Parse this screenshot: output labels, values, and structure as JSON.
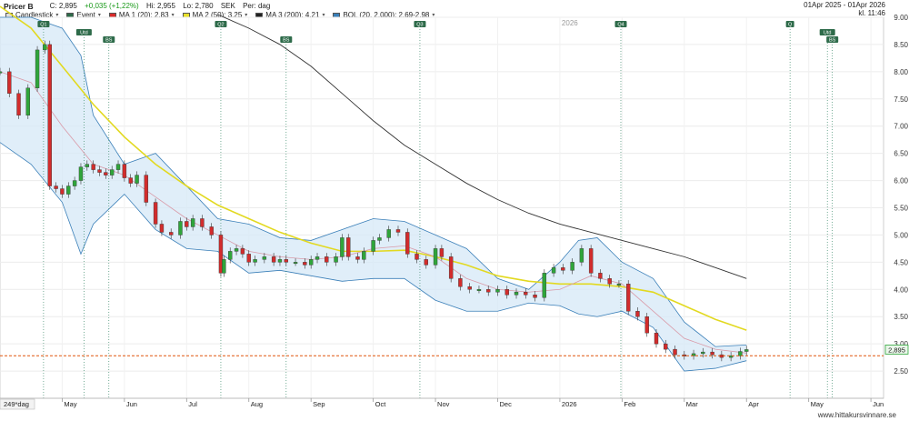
{
  "header": {
    "ticker": "Pricer B",
    "close": "C: 2,895",
    "change": "+0,035 (+1,22%)",
    "high": "Hi: 2,955",
    "low": "Lo: 2,780",
    "currency": "SEK",
    "period": "Per: dag",
    "date_range": "01Apr 2025 - 01Apr 2026",
    "time": "kl. 11:46",
    "legend": [
      {
        "label": "Candlestick",
        "color": "#dddddd"
      },
      {
        "label": "Event",
        "color": "#2e6b4a"
      },
      {
        "label": "MA 1 (20): 2.83",
        "color": "#d82b2b"
      },
      {
        "label": "MA 2 (50): 3.25",
        "color": "#e8e02a"
      },
      {
        "label": "MA 3 (200): 4.21",
        "color": "#222222"
      },
      {
        "label": "BOL (20, 2.000): 2.69-2.98",
        "color": "#3a7fb8"
      }
    ]
  },
  "footer": {
    "lookback": "249*dag",
    "credit": "www.hittakursvinnare.se"
  },
  "chart_data": {
    "type": "line",
    "title": "Pricer B",
    "ylim": [
      2.0,
      9.0
    ],
    "y_ticks": [
      "2.50",
      "3.00",
      "3.50",
      "4.00",
      "4.50",
      "5.00",
      "5.50",
      "6.00",
      "6.50",
      "7.00",
      "7.50",
      "8.00",
      "8.50",
      "9.00"
    ],
    "y_tick_values": [
      2.5,
      3.0,
      3.5,
      4.0,
      4.5,
      5.0,
      5.5,
      6.0,
      6.5,
      7.0,
      7.5,
      8.0,
      8.5,
      9.0
    ],
    "x_labels": [
      "May",
      "Jun",
      "Jul",
      "Aug",
      "Sep",
      "Oct",
      "Nov",
      "Dec",
      "2026",
      "Feb",
      "Mar",
      "Apr",
      "May",
      "Jun"
    ],
    "x_label_months": [
      1,
      2,
      3,
      4,
      5,
      6,
      7,
      8,
      9,
      10,
      11,
      12,
      13,
      14
    ],
    "year_label": "2026",
    "last_price": "2,895",
    "last_price_value": 2.895,
    "reference_level": 2.78,
    "grid": true,
    "events": [
      {
        "label": "Q1",
        "month": 0.7
      },
      {
        "label": "Utd",
        "month": 1.35
      },
      {
        "label": "BS",
        "month": 1.75
      },
      {
        "label": "Q2",
        "month": 3.55
      },
      {
        "label": "BS",
        "month": 4.6
      },
      {
        "label": "Q3",
        "month": 6.75
      },
      {
        "label": "Q4",
        "month": 9.98
      },
      {
        "label": "Q",
        "month": 12.7
      },
      {
        "label": "Utd",
        "month": 13.3
      },
      {
        "label": "BS",
        "month": 13.38
      }
    ],
    "series": [
      {
        "name": "Close",
        "month": [
          0.0,
          0.15,
          0.3,
          0.45,
          0.6,
          0.72,
          0.8,
          0.9,
          1.0,
          1.1,
          1.2,
          1.3,
          1.4,
          1.5,
          1.6,
          1.7,
          1.8,
          1.9,
          2.0,
          2.1,
          2.2,
          2.35,
          2.5,
          2.6,
          2.75,
          2.9,
          3.0,
          3.1,
          3.25,
          3.4,
          3.55,
          3.6,
          3.7,
          3.8,
          3.9,
          4.0,
          4.1,
          4.25,
          4.4,
          4.5,
          4.6,
          4.75,
          4.9,
          5.0,
          5.1,
          5.25,
          5.4,
          5.5,
          5.6,
          5.75,
          5.85,
          6.0,
          6.1,
          6.25,
          6.4,
          6.55,
          6.7,
          6.85,
          7.0,
          7.1,
          7.25,
          7.4,
          7.55,
          7.7,
          7.85,
          8.0,
          8.15,
          8.3,
          8.45,
          8.6,
          8.75,
          8.9,
          9.05,
          9.2,
          9.35,
          9.5,
          9.65,
          9.8,
          9.95,
          10.1,
          10.25,
          10.4,
          10.55,
          10.7,
          10.85,
          11.0,
          11.15,
          11.3,
          11.45,
          11.6,
          11.75,
          11.9,
          12.0
        ],
        "values": [
          8.0,
          7.6,
          7.2,
          7.7,
          8.4,
          8.5,
          5.9,
          5.85,
          5.75,
          5.9,
          6.0,
          6.25,
          6.3,
          6.2,
          6.15,
          6.1,
          6.2,
          6.3,
          6.05,
          5.95,
          6.1,
          5.6,
          5.2,
          5.05,
          5.0,
          5.25,
          5.15,
          5.3,
          5.15,
          5.0,
          4.3,
          4.55,
          4.7,
          4.75,
          4.65,
          4.5,
          4.55,
          4.6,
          4.5,
          4.55,
          4.5,
          4.5,
          4.45,
          4.55,
          4.6,
          4.5,
          4.6,
          4.95,
          4.6,
          4.55,
          4.7,
          4.9,
          4.95,
          5.1,
          5.05,
          4.65,
          4.55,
          4.45,
          4.75,
          4.6,
          4.2,
          4.05,
          4.0,
          4.0,
          3.95,
          4.0,
          3.9,
          3.95,
          3.9,
          3.85,
          4.3,
          4.4,
          4.35,
          4.5,
          4.75,
          4.3,
          4.2,
          4.1,
          4.1,
          3.6,
          3.5,
          3.2,
          3.0,
          2.9,
          2.8,
          2.78,
          2.82,
          2.85,
          2.8,
          2.75,
          2.78,
          2.86,
          2.895
        ]
      },
      {
        "name": "MA 1 (20)",
        "month": [
          0.0,
          0.5,
          1.0,
          1.5,
          2.0,
          2.5,
          3.0,
          3.5,
          4.0,
          4.5,
          5.0,
          5.5,
          6.0,
          6.5,
          7.0,
          7.5,
          8.0,
          8.5,
          9.0,
          9.5,
          10.0,
          10.5,
          11.0,
          11.5,
          12.0
        ],
        "values": [
          8.0,
          7.8,
          7.0,
          6.3,
          6.1,
          5.7,
          5.3,
          5.0,
          4.7,
          4.6,
          4.55,
          4.6,
          4.75,
          4.8,
          4.6,
          4.2,
          4.0,
          3.95,
          4.0,
          4.25,
          4.1,
          3.6,
          3.1,
          2.9,
          2.83
        ]
      },
      {
        "name": "MA 2 (50)",
        "month": [
          0.0,
          0.5,
          1.0,
          1.5,
          2.0,
          2.5,
          3.0,
          3.5,
          4.0,
          4.5,
          5.0,
          5.5,
          6.0,
          6.5,
          7.0,
          7.5,
          8.0,
          8.5,
          9.0,
          9.5,
          10.0,
          10.5,
          11.0,
          11.5,
          12.0
        ],
        "values": [
          9.2,
          8.8,
          8.1,
          7.4,
          6.8,
          6.3,
          5.9,
          5.55,
          5.3,
          5.05,
          4.85,
          4.7,
          4.7,
          4.72,
          4.6,
          4.45,
          4.25,
          4.15,
          4.1,
          4.1,
          4.05,
          3.95,
          3.7,
          3.45,
          3.25
        ]
      },
      {
        "name": "MA 3 (200)",
        "month": [
          3.5,
          4.0,
          4.5,
          5.0,
          5.5,
          6.0,
          6.5,
          7.0,
          7.5,
          8.0,
          8.5,
          9.0,
          9.5,
          10.0,
          10.5,
          11.0,
          11.5,
          12.0
        ],
        "values": [
          9.05,
          8.8,
          8.5,
          8.1,
          7.6,
          7.1,
          6.65,
          6.3,
          5.95,
          5.65,
          5.4,
          5.2,
          5.05,
          4.9,
          4.75,
          4.6,
          4.4,
          4.2
        ]
      },
      {
        "name": "BOL upper",
        "month": [
          0.0,
          0.5,
          1.0,
          1.3,
          1.5,
          2.0,
          2.5,
          3.0,
          3.5,
          4.0,
          4.5,
          5.0,
          5.5,
          6.0,
          6.5,
          7.0,
          7.5,
          8.0,
          8.5,
          9.0,
          9.3,
          9.6,
          10.0,
          10.5,
          11.0,
          11.5,
          12.0
        ],
        "values": [
          9.0,
          9.0,
          8.8,
          8.3,
          7.2,
          6.3,
          6.5,
          5.9,
          5.3,
          5.2,
          4.95,
          4.9,
          5.1,
          5.3,
          5.25,
          5.0,
          4.75,
          4.2,
          4.0,
          4.5,
          4.9,
          4.95,
          4.5,
          4.2,
          3.4,
          2.95,
          2.98
        ]
      },
      {
        "name": "BOL lower",
        "month": [
          0.0,
          0.5,
          1.0,
          1.3,
          1.5,
          2.0,
          2.5,
          3.0,
          3.5,
          4.0,
          4.5,
          5.0,
          5.5,
          6.0,
          6.5,
          7.0,
          7.5,
          8.0,
          8.5,
          9.0,
          9.3,
          9.6,
          10.0,
          10.5,
          11.0,
          11.5,
          12.0
        ],
        "values": [
          6.7,
          6.3,
          5.6,
          4.65,
          5.2,
          5.75,
          5.1,
          4.75,
          4.7,
          4.3,
          4.35,
          4.25,
          4.15,
          4.2,
          4.2,
          3.8,
          3.6,
          3.6,
          3.75,
          3.7,
          3.55,
          3.5,
          3.6,
          3.3,
          2.5,
          2.55,
          2.69
        ]
      }
    ]
  }
}
